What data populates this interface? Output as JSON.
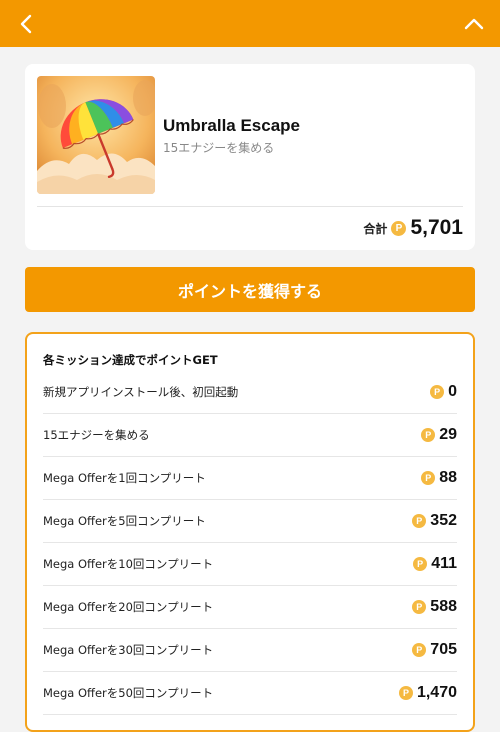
{
  "header": {
    "back_icon": "chevron-left-icon",
    "collapse_icon": "chevron-up-icon",
    "background_color": "#f39800"
  },
  "app": {
    "title": "Umbralla Escape",
    "subtitle": "15エナジーを集める",
    "total_label": "合計",
    "coin_glyph": "P",
    "total_points": "5,701"
  },
  "cta": {
    "label": "ポイントを獲得する"
  },
  "missions": {
    "title": "各ミッション達成でポイントGET",
    "items": [
      {
        "label": "新規アプリインストール後、初回起動",
        "points": "0"
      },
      {
        "label": "15エナジーを集める",
        "points": "29"
      },
      {
        "label": "Mega Offerを1回コンプリート",
        "points": "88"
      },
      {
        "label": "Mega Offerを5回コンプリート",
        "points": "352"
      },
      {
        "label": "Mega Offerを10回コンプリート",
        "points": "411"
      },
      {
        "label": "Mega Offerを20回コンプリート",
        "points": "588"
      },
      {
        "label": "Mega Offerを30回コンプリート",
        "points": "705"
      },
      {
        "label": "Mega Offerを50回コンプリート",
        "points": "1,470"
      }
    ]
  },
  "colors": {
    "accent": "#f39800",
    "coin": "#f5b941"
  }
}
